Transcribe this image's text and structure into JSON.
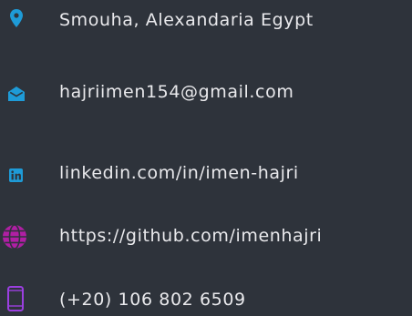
{
  "contact": {
    "location": {
      "text": "Smouha, Alexandaria Egypt",
      "icon": "map-pin-icon",
      "color": "#1e9bd7"
    },
    "email": {
      "text": "hajriimen154@gmail.com",
      "icon": "envelope-open-icon",
      "color": "#1e9bd7"
    },
    "linkedin": {
      "text": "linkedin.com/in/imen-hajri",
      "icon": "linkedin-icon",
      "color": "#1e9bd7"
    },
    "github": {
      "text": "https://github.com/imenhajri",
      "icon": "globe-icon",
      "color": "#b01fa4"
    },
    "phone": {
      "text": "(+20) 106 802 6509",
      "icon": "mobile-phone-icon",
      "color": "#9b3fe0"
    }
  },
  "colors": {
    "background": "#2e333b",
    "text": "#e9e9ec"
  }
}
